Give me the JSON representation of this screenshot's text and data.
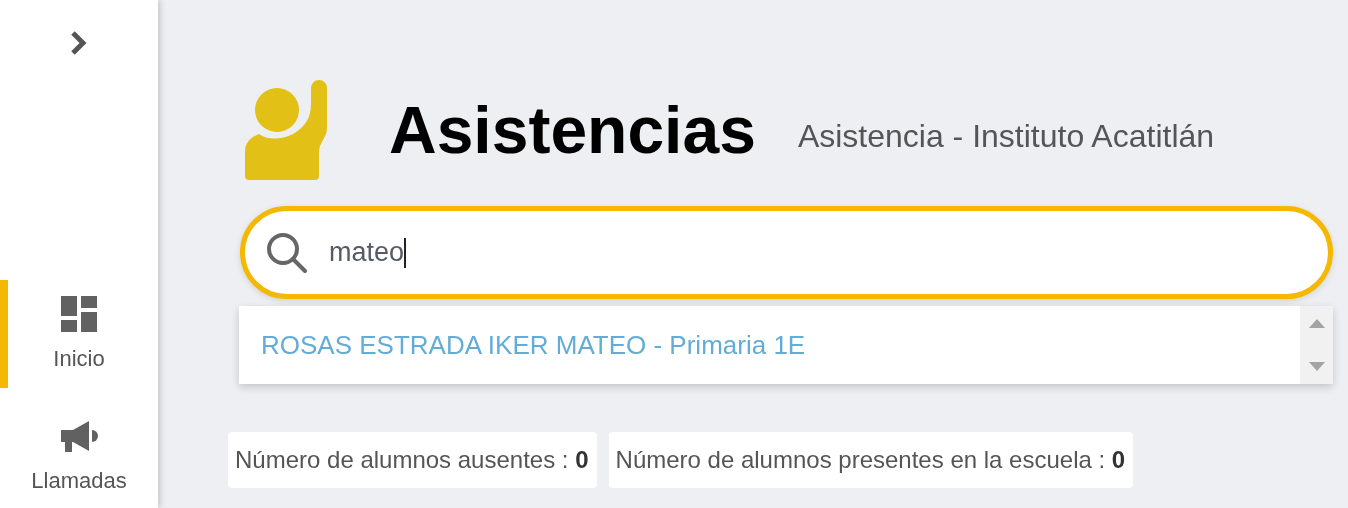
{
  "sidebar": {
    "items": [
      {
        "label": "Inicio",
        "selected": true
      },
      {
        "label": "Llamadas",
        "selected": false
      }
    ]
  },
  "header": {
    "title": "Asistencias",
    "subtitle": "Asistencia - Instituto Acatitlán"
  },
  "search": {
    "value": "mateo",
    "suggestions": [
      {
        "label": "ROSAS ESTRADA IKER MATEO - Primaria 1E"
      }
    ]
  },
  "stats": [
    {
      "text": "Número de alumnos ausentes : **0**"
    },
    {
      "text": "Número de alumnos presentes en la escuela : **0**"
    }
  ]
}
